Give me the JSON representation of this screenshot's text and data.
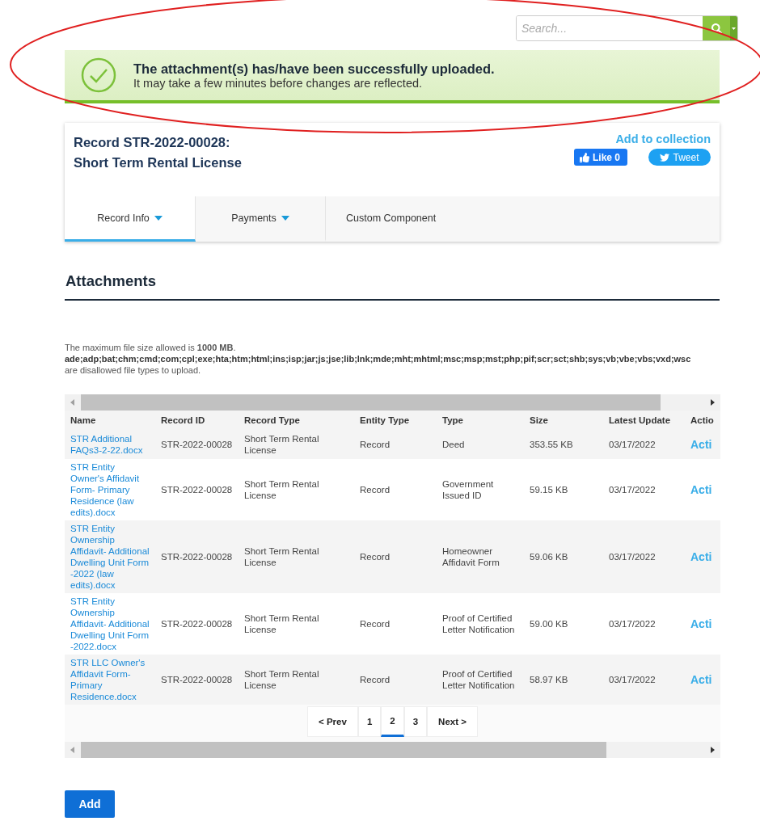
{
  "search": {
    "placeholder": "Search..."
  },
  "banner": {
    "title": "The attachment(s) has/have been successfully uploaded.",
    "message": "It may take a few minutes before changes are reflected."
  },
  "record": {
    "title_line1": "Record STR-2022-00028:",
    "title_line2": "Short Term Rental License",
    "add_to_collection": "Add to collection",
    "like_button": "Like 0",
    "tweet_button": "Tweet"
  },
  "tabs": [
    {
      "label": "Record Info",
      "has_menu": true,
      "selected": true
    },
    {
      "label": "Payments",
      "has_menu": true,
      "selected": false
    },
    {
      "label": "Custom Component",
      "has_menu": false,
      "selected": false
    }
  ],
  "attachments": {
    "heading": "Attachments",
    "size_note": "The maximum file size allowed is **1000 MB**.",
    "disallowed_types": "ade;adp;bat;chm;cmd;com;cpl;exe;hta;htm;html;ins;isp;jar;js;jse;lib;lnk;mde;mht;mhtml;msc;msp;mst;php;pif;scr;sct;shb;sys;vb;vbe;vbs;vxd;wsc",
    "disallowed_note": "are disallowed file types to upload."
  },
  "table": {
    "columns": [
      "Name",
      "Record ID",
      "Record Type",
      "Entity Type",
      "Type",
      "Size",
      "Latest Update",
      "Actio"
    ],
    "rows": [
      {
        "name": "STR Additional FAQs3-2-22.docx",
        "record_id": "STR-2022-00028",
        "record_type": "Short Term Rental License",
        "entity_type": "Record",
        "type": "Deed",
        "size": "353.55 KB",
        "latest_update": "03/17/2022",
        "action": "Acti"
      },
      {
        "name": "STR Entity Owner's Affidavit Form- Primary Residence (law edits).docx",
        "record_id": "STR-2022-00028",
        "record_type": "Short Term Rental License",
        "entity_type": "Record",
        "type": "Government Issued ID",
        "size": "59.15 KB",
        "latest_update": "03/17/2022",
        "action": "Acti"
      },
      {
        "name": "STR Entity Ownership Affidavit- Additional Dwelling Unit Form -2022 (law edits).docx",
        "record_id": "STR-2022-00028",
        "record_type": "Short Term Rental License",
        "entity_type": "Record",
        "type": "Homeowner Affidavit Form",
        "size": "59.06 KB",
        "latest_update": "03/17/2022",
        "action": "Acti"
      },
      {
        "name": "STR Entity Ownership Affidavit- Additional Dwelling Unit Form -2022.docx",
        "record_id": "STR-2022-00028",
        "record_type": "Short Term Rental License",
        "entity_type": "Record",
        "type": "Proof of Certified Letter Notification",
        "size": "59.00 KB",
        "latest_update": "03/17/2022",
        "action": "Acti"
      },
      {
        "name": "STR LLC Owner's Affidavit Form- Primary Residence.docx",
        "record_id": "STR-2022-00028",
        "record_type": "Short Term Rental License",
        "entity_type": "Record",
        "type": "Proof of Certified Letter Notification",
        "size": "58.97 KB",
        "latest_update": "03/17/2022",
        "action": "Acti"
      }
    ]
  },
  "pagination": [
    {
      "label": "< Prev",
      "selected": false
    },
    {
      "label": "1",
      "selected": false
    },
    {
      "label": "2",
      "selected": true
    },
    {
      "label": "3",
      "selected": false
    },
    {
      "label": "Next >",
      "selected": false
    }
  ],
  "add_button": "Add",
  "annotation": {
    "kind": "ellipse"
  }
}
